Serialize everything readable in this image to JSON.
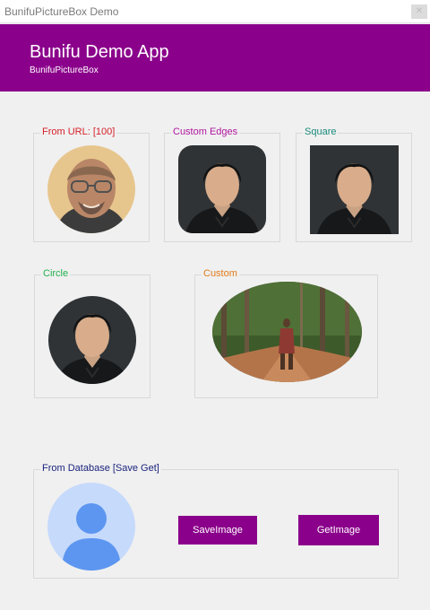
{
  "window": {
    "title": "BunifuPictureBox Demo"
  },
  "header": {
    "app_title": "Bunifu Demo App",
    "subtitle": "BunifuPictureBox"
  },
  "groups": {
    "from_url": {
      "label": "From URL: [100]",
      "color": "#d6202a"
    },
    "custom_edges": {
      "label": "Custom Edges",
      "color": "#b0179f"
    },
    "square": {
      "label": "Square",
      "color": "#178a7a"
    },
    "circle": {
      "label": "Circle",
      "color": "#22b14c"
    },
    "custom": {
      "label": "Custom",
      "color": "#e07a1a"
    },
    "database": {
      "label": "From Database [Save  Get]",
      "color": "#1a237e"
    }
  },
  "buttons": {
    "save_image": "SaveImage",
    "get_image": "GetImage"
  },
  "colors": {
    "accent": "#8b008b",
    "avatar_bg": "#c6dafc",
    "avatar_fg": "#5d96f0"
  }
}
